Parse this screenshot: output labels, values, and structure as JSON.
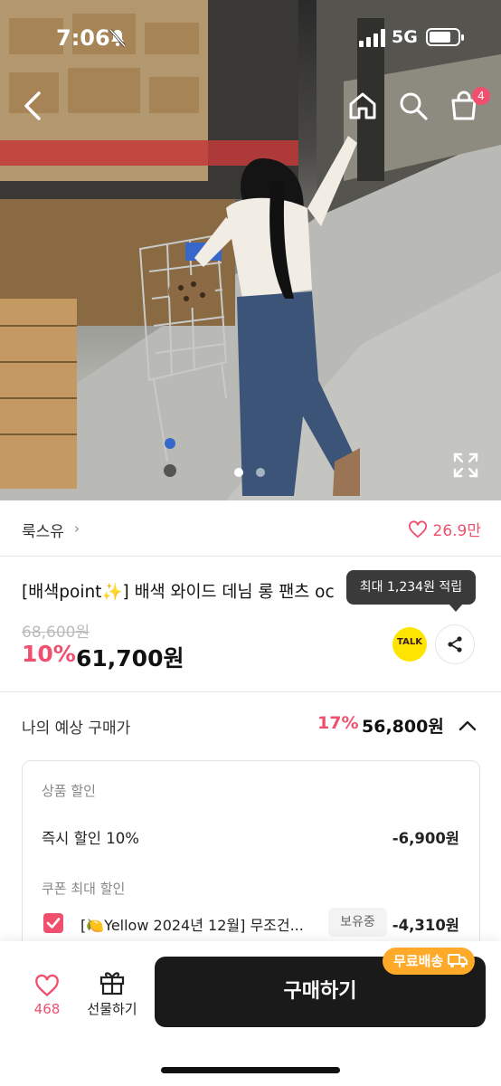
{
  "status_bar": {
    "time": "7:06",
    "network": "5G",
    "battery_level": 0.75
  },
  "header": {
    "back_icon": "chevron-left-icon",
    "home_icon": "home-icon",
    "search_icon": "search-icon",
    "cart_icon": "shopping-bag-icon",
    "cart_count": "4"
  },
  "gallery": {
    "total_images": 2,
    "active_index": 0
  },
  "seller": {
    "name": "룩스유",
    "chevron": "›",
    "likes": "26.9만"
  },
  "product": {
    "title": "[배색point✨] 배색 와이드 데님 롱 팬츠 oc",
    "reward_tooltip": "최대 1,234원 적립",
    "original_price": "68,600원",
    "discount_percent": "10%",
    "sale_price": "61,700원",
    "kakao_label": "TALK"
  },
  "expected": {
    "label": "나의 예상 구매가",
    "percent": "17%",
    "price": "56,800원"
  },
  "discount_detail": {
    "product_discount_head": "상품 할인",
    "instant_label": "즉시 할인 10%",
    "instant_amount": "-6,900원",
    "coupon_head": "쿠폰 최대 할인",
    "coupon_name": "[🍋Yellow 2024년 12월] 무조건...",
    "coupon_status": "보유중",
    "coupon_amount": "-4,310원",
    "coupon_checked": true
  },
  "bottom_bar": {
    "wish_count": "468",
    "gift_label": "선물하기",
    "buy_label": "구매하기",
    "free_shipping": "무료배송"
  },
  "colors": {
    "accent": "#f0506e",
    "buy_button": "#1a1a1a",
    "free_ship": "#ffa928",
    "kakao": "#fee500"
  }
}
